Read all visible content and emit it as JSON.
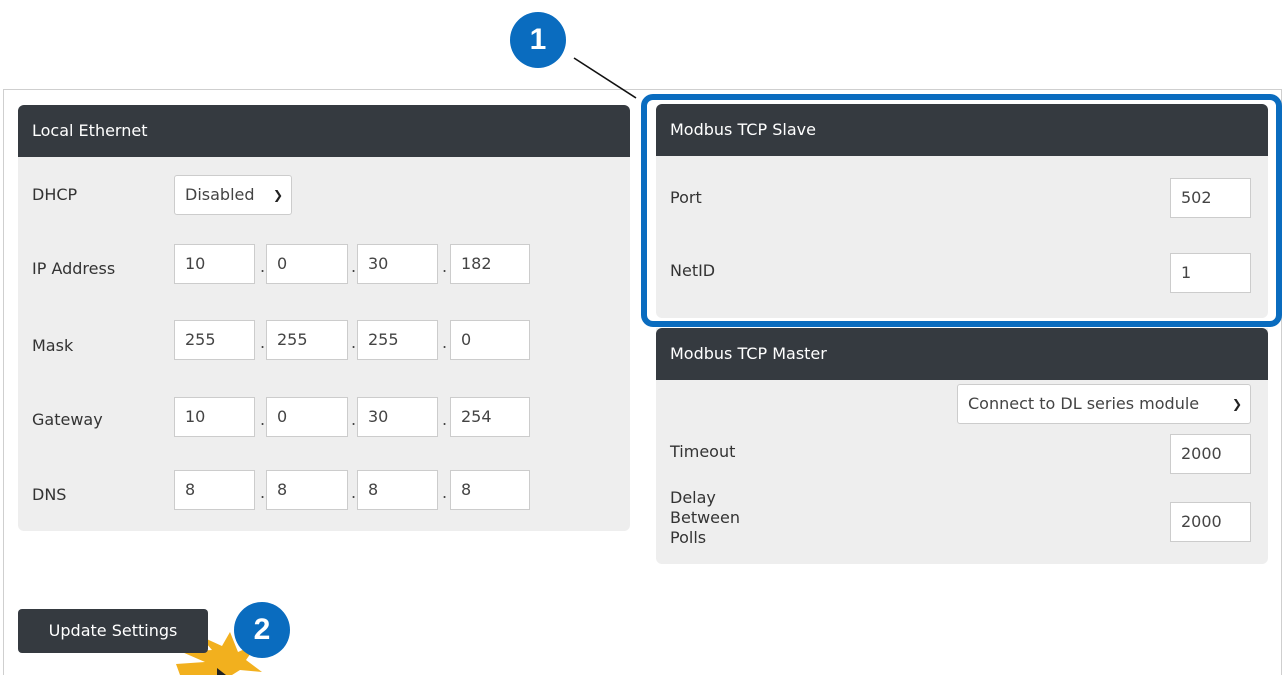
{
  "colors": {
    "header_bg": "#353a40",
    "panel_bg": "#eeeeee",
    "callout_blue": "#0a6cbf",
    "burst": "#f2b01e"
  },
  "callouts": {
    "one": "1",
    "two": "2"
  },
  "local_ethernet": {
    "title": "Local Ethernet",
    "dhcp_label": "DHCP",
    "dhcp_value": "Disabled",
    "ip_label": "IP Address",
    "ip": [
      "10",
      "0",
      "30",
      "182"
    ],
    "mask_label": "Mask",
    "mask": [
      "255",
      "255",
      "255",
      "0"
    ],
    "gateway_label": "Gateway",
    "gateway": [
      "10",
      "0",
      "30",
      "254"
    ],
    "dns_label": "DNS",
    "dns": [
      "8",
      "8",
      "8",
      "8"
    ],
    "separator": "."
  },
  "modbus_slave": {
    "title": "Modbus TCP Slave",
    "port_label": "Port",
    "port_value": "502",
    "netid_label": "NetID",
    "netid_value": "1"
  },
  "modbus_master": {
    "title": "Modbus TCP Master",
    "mode_value": "Connect to DL series module",
    "timeout_label": "Timeout",
    "timeout_value": "2000",
    "delay_label_1": "Delay",
    "delay_label_2": "Between",
    "delay_label_3": "Polls",
    "delay_value": "2000"
  },
  "actions": {
    "update_label": "Update Settings"
  }
}
